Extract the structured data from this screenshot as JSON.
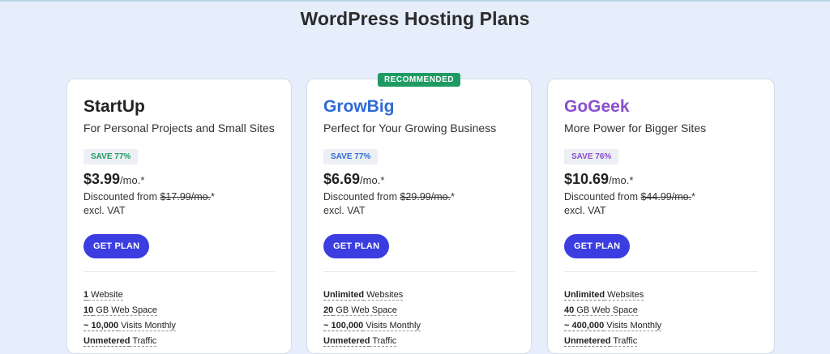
{
  "page": {
    "title": "WordPress Hosting Plans"
  },
  "plans": [
    {
      "name": "StartUp",
      "name_color": "#222222",
      "tagline": "For Personal Projects and Small Sites",
      "save": "SAVE 77%",
      "save_color": "#1f9a63",
      "price": "$3.99",
      "per": "/mo.*",
      "discount_prefix": "Discounted from ",
      "original_price": "$17.99/mo.",
      "discount_suffix": "*",
      "vat": "excl. VAT",
      "button": "GET PLAN",
      "features": [
        {
          "bold": "1",
          "rest": " Website"
        },
        {
          "bold": "10",
          "rest": " GB Web Space"
        },
        {
          "bold": "~ 10,000",
          "rest": " Visits Monthly"
        },
        {
          "bold": "Unmetered",
          "rest": " Traffic"
        }
      ]
    },
    {
      "badge": "RECOMMENDED",
      "name": "GrowBig",
      "name_color": "#2e6bd6",
      "tagline": "Perfect for Your Growing Business",
      "save": "SAVE 77%",
      "save_color": "#2e6bd6",
      "price": "$6.69",
      "per": "/mo.*",
      "discount_prefix": "Discounted from ",
      "original_price": "$29.99/mo.",
      "discount_suffix": "*",
      "vat": "excl. VAT",
      "button": "GET PLAN",
      "features": [
        {
          "bold": "Unlimited",
          "rest": " Websites"
        },
        {
          "bold": "20",
          "rest": " GB Web Space"
        },
        {
          "bold": "~ 100,000",
          "rest": " Visits Monthly"
        },
        {
          "bold": "Unmetered",
          "rest": " Traffic"
        }
      ]
    },
    {
      "name": "GoGeek",
      "name_color": "#8a4fcf",
      "tagline": "More Power for Bigger Sites",
      "save": "SAVE 76%",
      "save_color": "#8a4fcf",
      "price": "$10.69",
      "per": "/mo.*",
      "discount_prefix": "Discounted from ",
      "original_price": "$44.99/mo.",
      "discount_suffix": "*",
      "vat": "excl. VAT",
      "button": "GET PLAN",
      "features": [
        {
          "bold": "Unlimited",
          "rest": " Websites"
        },
        {
          "bold": "40",
          "rest": " GB Web Space"
        },
        {
          "bold": "~ 400,000",
          "rest": " Visits Monthly"
        },
        {
          "bold": "Unmetered",
          "rest": " Traffic"
        }
      ]
    }
  ]
}
